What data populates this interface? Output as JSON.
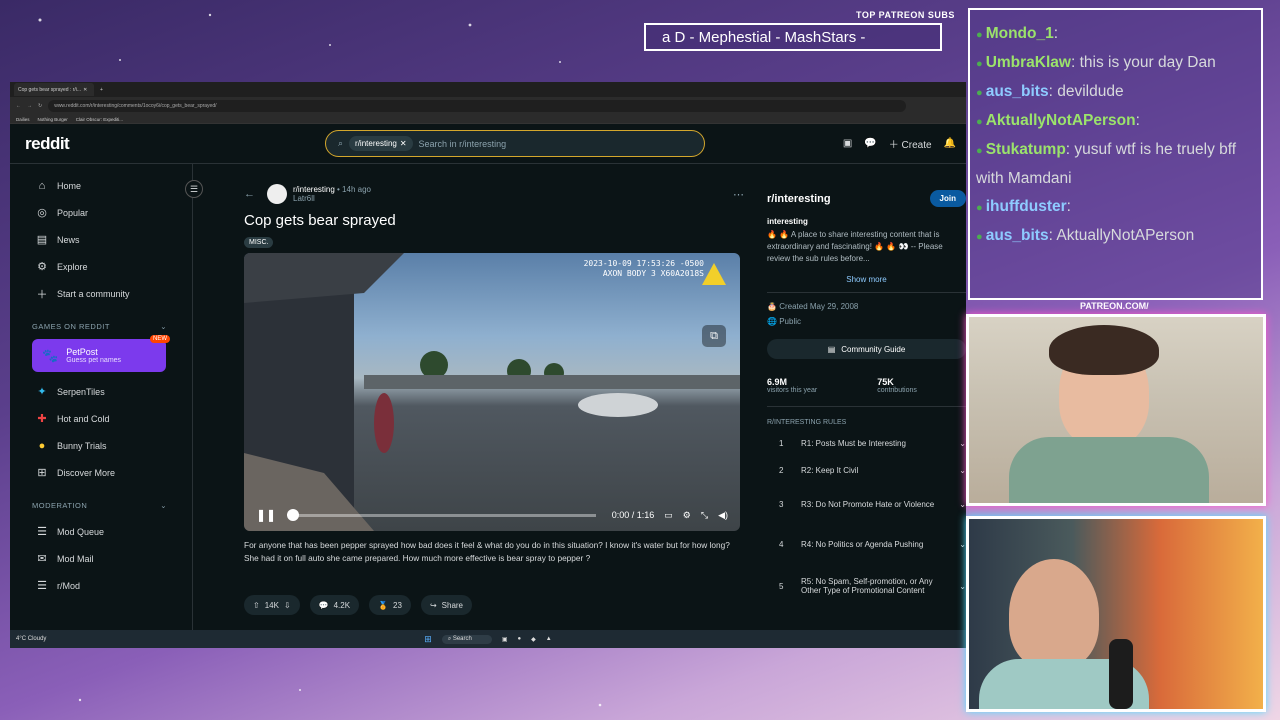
{
  "overlay": {
    "patreon_top": "TOP PATREON SUBS",
    "ticker": "a D - Mephestial - MashStars -",
    "patreon_url": "PATREON.COM/"
  },
  "browser": {
    "tab_title": "Cop gets bear sprayed : r/i...",
    "url": "www.reddit.com/r/interesting/comments/1ocoy6i/cop_gets_bear_sprayed/",
    "bookmarks": [
      "Dailies",
      "Nothing Burger",
      "Clair Obscur: Expediti..."
    ]
  },
  "reddit": {
    "logo": "reddit",
    "search": {
      "chip": "r/interesting",
      "placeholder": "Search in r/interesting"
    },
    "create_label": "Create",
    "sidebar": {
      "nav": [
        {
          "label": "Home",
          "icon": "home-icon"
        },
        {
          "label": "Popular",
          "icon": "popular-icon"
        },
        {
          "label": "News",
          "icon": "news-icon"
        },
        {
          "label": "Explore",
          "icon": "explore-icon"
        },
        {
          "label": "Start a community",
          "icon": "plus-icon"
        }
      ],
      "games_header": "GAMES ON REDDIT",
      "petpost": {
        "title": "PetPost",
        "subtitle": "Guess pet names",
        "badge": "NEW"
      },
      "games": [
        {
          "label": "SerpenTiles"
        },
        {
          "label": "Hot and Cold"
        },
        {
          "label": "Bunny Trials"
        },
        {
          "label": "Discover More"
        }
      ],
      "moderation_header": "MODERATION",
      "moderation": [
        {
          "label": "Mod Queue"
        },
        {
          "label": "Mod Mail"
        },
        {
          "label": "r/Mod"
        }
      ]
    },
    "post": {
      "subreddit": "r/interesting",
      "time": "• 14h ago",
      "author": "Latr6ll",
      "title": "Cop gets bear sprayed",
      "flair": "MISC.",
      "video": {
        "timestamp_line1": "2023-10-09 17:53:26 -0500",
        "timestamp_line2": "AXON BODY 3 X60A2018S",
        "time": "0:00 / 1:16",
        "progress": 0
      },
      "body": "For anyone that has been pepper sprayed how bad does it feel & what do you do in this situation? I know it's water but for how long? She had it on full auto she came prepared. How much more effective is bear spray to pepper ?",
      "votes": "14K",
      "comments": "4.2K",
      "awards": "23",
      "share": "Share"
    },
    "community": {
      "name": "r/interesting",
      "join": "Join",
      "about_title": "interesting",
      "about": "🔥 🔥 A place to share interesting content that is extraordinary and fascinating! 🔥 🔥 👀 -- Please review the sub rules before...",
      "show_more": "Show more",
      "created": "Created May 29, 2008",
      "visibility": "Public",
      "guide": "Community Guide",
      "visitors": "6.9M",
      "visitors_label": "visitors this year",
      "contributions": "75K",
      "contributions_label": "contributions",
      "rules_header": "R/INTERESTING RULES",
      "rules": [
        {
          "n": "1",
          "text": "R1: Posts Must be Interesting"
        },
        {
          "n": "2",
          "text": "R2: Keep It Civil"
        },
        {
          "n": "3",
          "text": "R3: Do Not Promote Hate or Violence"
        },
        {
          "n": "4",
          "text": "R4: No Politics or Agenda Pushing"
        },
        {
          "n": "5",
          "text": "R5: No Spam, Self-promotion, or Any Other Type of Promotional Content"
        }
      ]
    }
  },
  "taskbar": {
    "weather": "4°C Cloudy",
    "search": "Search"
  },
  "chat": [
    {
      "user": "Mondo_1",
      "msg": "",
      "color": "#9be36b"
    },
    {
      "user": "UmbraKlaw",
      "msg": "this is your day Dan",
      "color": "#9be36b"
    },
    {
      "user": "aus_bits",
      "msg": "devildude",
      "color": "#8ecbff"
    },
    {
      "user": "AktuallyNotAPerson",
      "msg": "",
      "color": "#9be36b"
    },
    {
      "user": "Stukatump",
      "msg": "yusuf wtf is he truely bff with Mamdani",
      "color": "#9be36b"
    },
    {
      "user": "ihuffduster",
      "msg": "",
      "color": "#8ecbff"
    },
    {
      "user": "aus_bits",
      "msg": "AktuallyNotAPerson",
      "color": "#8ecbff"
    }
  ],
  "colors": {
    "accent": "#d4a72c",
    "join": "#0a5aa0",
    "petpost": "#7c3aed"
  }
}
